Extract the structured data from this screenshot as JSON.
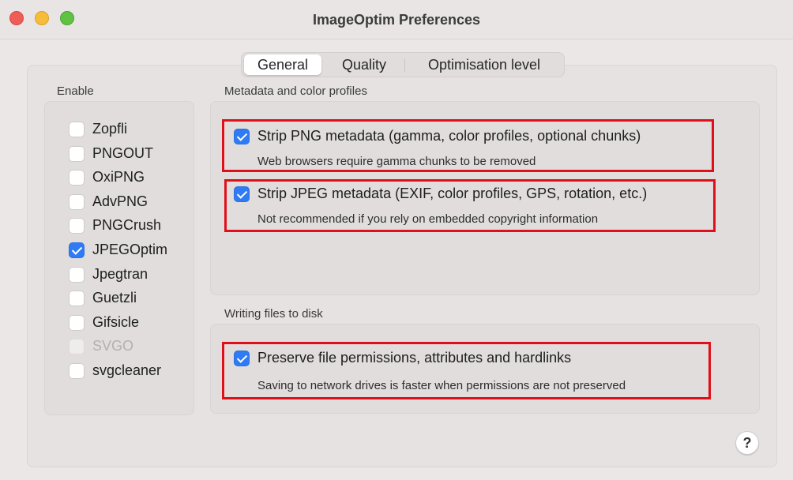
{
  "window": {
    "title": "ImageOptim Preferences"
  },
  "tabs": [
    {
      "label": "General",
      "selected": true
    },
    {
      "label": "Quality",
      "selected": false
    },
    {
      "label": "Optimisation level",
      "selected": false
    }
  ],
  "enable": {
    "heading": "Enable",
    "items": [
      {
        "label": "Zopfli",
        "checked": false,
        "disabled": false
      },
      {
        "label": "PNGOUT",
        "checked": false,
        "disabled": false
      },
      {
        "label": "OxiPNG",
        "checked": false,
        "disabled": false
      },
      {
        "label": "AdvPNG",
        "checked": false,
        "disabled": false
      },
      {
        "label": "PNGCrush",
        "checked": false,
        "disabled": false
      },
      {
        "label": "JPEGOptim",
        "checked": true,
        "disabled": false
      },
      {
        "label": "Jpegtran",
        "checked": false,
        "disabled": false
      },
      {
        "label": "Guetzli",
        "checked": false,
        "disabled": false
      },
      {
        "label": "Gifsicle",
        "checked": false,
        "disabled": false
      },
      {
        "label": "SVGO",
        "checked": false,
        "disabled": true
      },
      {
        "label": "svgcleaner",
        "checked": false,
        "disabled": false
      }
    ]
  },
  "metadata": {
    "heading": "Metadata and color profiles",
    "options": [
      {
        "title": "Strip PNG metadata (gamma, color profiles, optional chunks)",
        "description": "Web browsers require gamma chunks to be removed",
        "checked": true
      },
      {
        "title": "Strip JPEG metadata (EXIF, color profiles, GPS, rotation, etc.)",
        "description": "Not recommended if you rely on embedded copyright information",
        "checked": true
      }
    ]
  },
  "writing": {
    "heading": "Writing files to disk",
    "option": {
      "title": "Preserve file permissions, attributes and hardlinks",
      "description": "Saving to network drives is faster when permissions are not preserved",
      "checked": true
    }
  },
  "help": {
    "label": "?"
  },
  "colors": {
    "accent": "#2f7bf5",
    "highlight": "#e0101a"
  }
}
